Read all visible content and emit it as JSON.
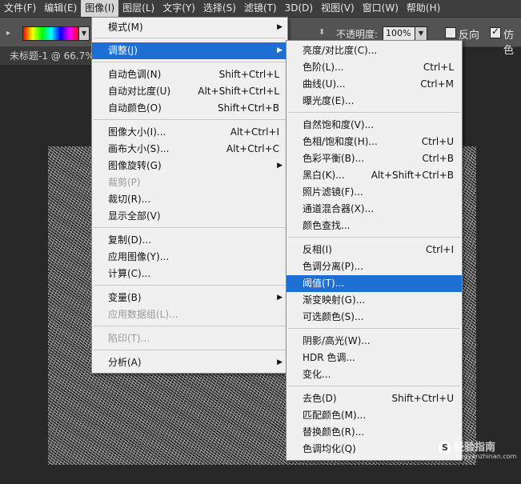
{
  "menubar": {
    "items": [
      "文件(F)",
      "编辑(E)",
      "图像(I)",
      "图层(L)",
      "文字(Y)",
      "选择(S)",
      "滤镜(T)",
      "3D(D)",
      "视图(V)",
      "窗口(W)",
      "帮助(H)"
    ]
  },
  "options_bar": {
    "opacity_label": "不透明度:",
    "opacity_value": "100%",
    "reverse_label": "反向",
    "dither_label": "仿色",
    "reverse_checked": false,
    "dither_checked": true
  },
  "document_tab": "未标题-1 @ 66.7%",
  "image_menu": {
    "items": [
      {
        "label": "模式(M)",
        "shortcut": "",
        "submenu": true
      },
      {
        "label": "调整(J)",
        "shortcut": "",
        "submenu": true,
        "highlighted": true
      },
      {
        "label": "自动色调(N)",
        "shortcut": "Shift+Ctrl+L"
      },
      {
        "label": "自动对比度(U)",
        "shortcut": "Alt+Shift+Ctrl+L"
      },
      {
        "label": "自动颜色(O)",
        "shortcut": "Shift+Ctrl+B"
      },
      {
        "label": "图像大小(I)...",
        "shortcut": "Alt+Ctrl+I"
      },
      {
        "label": "画布大小(S)...",
        "shortcut": "Alt+Ctrl+C"
      },
      {
        "label": "图像旋转(G)",
        "shortcut": "",
        "submenu": true
      },
      {
        "label": "裁剪(P)",
        "shortcut": "",
        "disabled": true
      },
      {
        "label": "裁切(R)...",
        "shortcut": ""
      },
      {
        "label": "显示全部(V)",
        "shortcut": ""
      },
      {
        "label": "复制(D)...",
        "shortcut": ""
      },
      {
        "label": "应用图像(Y)...",
        "shortcut": ""
      },
      {
        "label": "计算(C)...",
        "shortcut": ""
      },
      {
        "label": "变量(B)",
        "shortcut": "",
        "submenu": true
      },
      {
        "label": "应用数据组(L)...",
        "shortcut": "",
        "disabled": true
      },
      {
        "label": "陷印(T)...",
        "shortcut": "",
        "disabled": true
      },
      {
        "label": "分析(A)",
        "shortcut": "",
        "submenu": true
      }
    ]
  },
  "adjust_menu": {
    "items": [
      {
        "label": "亮度/对比度(C)...",
        "shortcut": ""
      },
      {
        "label": "色阶(L)...",
        "shortcut": "Ctrl+L"
      },
      {
        "label": "曲线(U)...",
        "shortcut": "Ctrl+M"
      },
      {
        "label": "曝光度(E)...",
        "shortcut": ""
      },
      {
        "label": "自然饱和度(V)...",
        "shortcut": ""
      },
      {
        "label": "色相/饱和度(H)...",
        "shortcut": "Ctrl+U"
      },
      {
        "label": "色彩平衡(B)...",
        "shortcut": "Ctrl+B"
      },
      {
        "label": "黑白(K)...",
        "shortcut": "Alt+Shift+Ctrl+B"
      },
      {
        "label": "照片滤镜(F)...",
        "shortcut": ""
      },
      {
        "label": "通道混合器(X)...",
        "shortcut": ""
      },
      {
        "label": "颜色查找...",
        "shortcut": ""
      },
      {
        "label": "反相(I)",
        "shortcut": "Ctrl+I"
      },
      {
        "label": "色调分离(P)...",
        "shortcut": ""
      },
      {
        "label": "阈值(T)...",
        "shortcut": "",
        "highlighted": true
      },
      {
        "label": "渐变映射(G)...",
        "shortcut": ""
      },
      {
        "label": "可选颜色(S)...",
        "shortcut": ""
      },
      {
        "label": "阴影/高光(W)...",
        "shortcut": ""
      },
      {
        "label": "HDR 色调...",
        "shortcut": ""
      },
      {
        "label": "变化...",
        "shortcut": ""
      },
      {
        "label": "去色(D)",
        "shortcut": "Shift+Ctrl+U"
      },
      {
        "label": "匹配颜色(M)...",
        "shortcut": ""
      },
      {
        "label": "替换颜色(R)...",
        "shortcut": ""
      },
      {
        "label": "色调均化(Q)",
        "shortcut": ""
      }
    ]
  },
  "watermark": {
    "text": "经验指南",
    "sub": "jingyanzhinan.com"
  },
  "colors": {
    "highlight": "#1e6fd4",
    "menu_bg": "#f0f0f0",
    "app_bg": "#282828"
  }
}
